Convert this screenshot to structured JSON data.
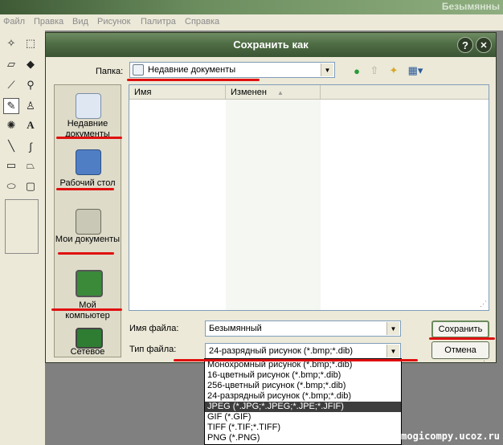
{
  "app": {
    "title": "Безымянны"
  },
  "menu": [
    "Файл",
    "Правка",
    "Вид",
    "Рисунок",
    "Палитра",
    "Справка"
  ],
  "toolbox": {
    "tools": [
      "free-select-icon",
      "rect-select-icon",
      "eraser-icon",
      "fill-icon",
      "color-picker-icon",
      "magnifier-icon",
      "pencil-icon",
      "brush-icon",
      "airbrush-icon",
      "text-icon",
      "line-icon",
      "curve-icon",
      "rectangle-icon",
      "polygon-icon",
      "ellipse-icon",
      "rounded-rect-icon"
    ]
  },
  "dialog": {
    "title": "Сохранить как",
    "help": "?",
    "close": "✕",
    "folder_label": "Папка:",
    "folder_value": "Недавние документы",
    "places": [
      {
        "label_line1": "Недавние",
        "label_line2": "документы",
        "icon": "recent-documents-icon"
      },
      {
        "label_line1": "Рабочий стол",
        "label_line2": "",
        "icon": "desktop-icon"
      },
      {
        "label_line1": "Мои документы",
        "label_line2": "",
        "icon": "my-documents-icon"
      },
      {
        "label_line1": "Мой",
        "label_line2": "компьютер",
        "icon": "my-computer-icon"
      },
      {
        "label_line1": "Сетевое",
        "label_line2": "",
        "icon": "network-icon"
      }
    ],
    "columns": {
      "name": "Имя",
      "modified": "Изменен"
    },
    "filename_label": "Имя файла:",
    "filename_value": "Безымянный",
    "filetype_label": "Тип файла:",
    "filetype_value": "24-разрядный рисунок (*.bmp;*.dib)",
    "save_label": "Сохранить",
    "cancel_label": "Отмена",
    "filetype_options": [
      "Монохромный рисунок (*.bmp;*.dib)",
      "16-цветный рисунок (*.bmp;*.dib)",
      "256-цветный рисунок (*.bmp;*.dib)",
      "24-разрядный рисунок (*.bmp;*.dib)",
      "JPEG (*.JPG;*.JPEG;*.JPE;*.JFIF)",
      "GIF (*.GIF)",
      "TIFF (*.TIF;*.TIFF)",
      "PNG (*.PNG)"
    ],
    "selected_option_index": 4
  },
  "watermark": "pomogicompy.ucoz.ru",
  "colors": {
    "highlight": "#e01010",
    "titlebar": "#4f6d45"
  }
}
